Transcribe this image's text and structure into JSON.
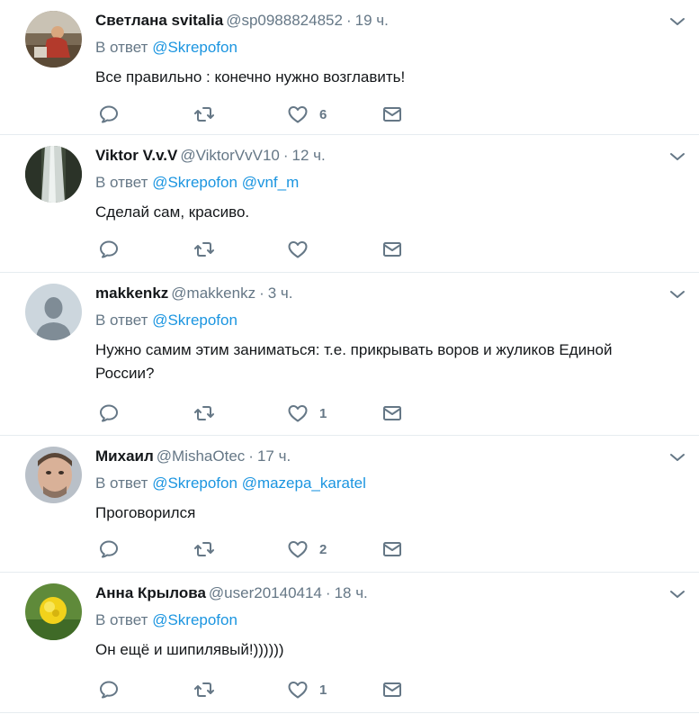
{
  "reply_prefix": "В ответ",
  "tweets": [
    {
      "name": "Светлана svitalia",
      "handle": "@sp0988824852",
      "separator": "·",
      "time": "19 ч.",
      "mentions": [
        "@Skrepofon"
      ],
      "text": "Все правильно : конечно нужно возглавить!",
      "likes": "6",
      "avatar": "avatar-photo-person-outdoors"
    },
    {
      "name": "Viktor V.v.V",
      "handle": "@ViktorVvV10",
      "separator": "·",
      "time": "12 ч.",
      "mentions": [
        "@Skrepofon",
        "@vnf_m"
      ],
      "text": "Сделай сам, красиво.",
      "likes": "",
      "avatar": "avatar-photo-waterfall"
    },
    {
      "name": "makkenkz",
      "handle": "@makkenkz",
      "separator": "·",
      "time": "3 ч.",
      "mentions": [
        "@Skrepofon"
      ],
      "text": "Нужно самим этим заниматься: т.е. прикрывать воров и жуликов Единой России?",
      "likes": "1",
      "avatar": "avatar-default-silhouette"
    },
    {
      "name": "Михаил",
      "handle": "@MishaOtec",
      "separator": "·",
      "time": "17 ч.",
      "mentions": [
        "@Skrepofon",
        "@mazepa_karatel"
      ],
      "text": "Проговорился",
      "likes": "2",
      "avatar": "avatar-photo-man-face"
    },
    {
      "name": "Анна Крылова",
      "handle": "@user20140414",
      "separator": "·",
      "time": "18 ч.",
      "mentions": [
        "@Skrepofon"
      ],
      "text": "Он ещё и шипилявый!))))))",
      "likes": "1",
      "avatar": "avatar-photo-yellow-flower"
    }
  ],
  "icons": {
    "reply": "reply-icon",
    "retweet": "retweet-icon",
    "like": "heart-icon",
    "message": "envelope-icon",
    "more": "chevron-down-icon"
  },
  "colors": {
    "link": "#1b95e0",
    "secondary": "#657786",
    "border": "#e6ecf0",
    "text": "#14171a"
  }
}
